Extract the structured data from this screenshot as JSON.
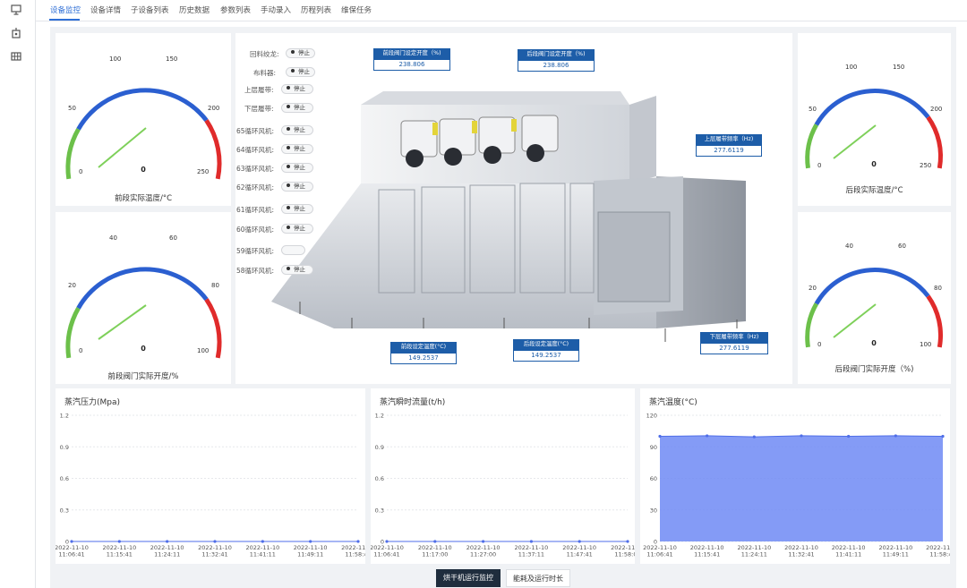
{
  "tabs": [
    "设备监控",
    "设备详情",
    "子设备列表",
    "历史数据",
    "参数列表",
    "手动录入",
    "历程列表",
    "维保任务"
  ],
  "left_rail_icons": [
    "monitor-icon",
    "device-icon",
    "grid-icon"
  ],
  "gauges": {
    "front_temp": {
      "title": "前段实际温度/°C",
      "value": "0",
      "ticks": [
        "0",
        "50",
        "100",
        "150",
        "200",
        "250"
      ]
    },
    "front_valve": {
      "title": "前段阀门实际开度/%",
      "value": "0",
      "ticks": [
        "0",
        "20",
        "40",
        "60",
        "80",
        "100"
      ]
    },
    "rear_temp": {
      "title": "后段实际温度/°C",
      "value": "0",
      "ticks": [
        "0",
        "50",
        "100",
        "150",
        "200",
        "250"
      ]
    },
    "rear_valve": {
      "title": "后段阀门实际开度（%)",
      "value": "0",
      "ticks": [
        "0",
        "20",
        "40",
        "60",
        "80",
        "100"
      ]
    }
  },
  "status": [
    {
      "label": "回料绞龙:",
      "value": "停止"
    },
    {
      "label": "布料器:",
      "value": "停止"
    },
    {
      "label": "上层履带:",
      "value": "停止"
    },
    {
      "label": "下层履带:",
      "value": "停止"
    },
    {
      "label": "65循环风机:",
      "value": "停止"
    },
    {
      "label": "64循环风机:",
      "value": "停止"
    },
    {
      "label": "63循环风机:",
      "value": "停止"
    },
    {
      "label": "62循环风机:",
      "value": "停止"
    },
    {
      "label": "61循环风机:",
      "value": "停止"
    },
    {
      "label": "60循环风机:",
      "value": "停止"
    },
    {
      "label": "59循环风机:",
      "value": ""
    },
    {
      "label": "58循环风机:",
      "value": "停止"
    }
  ],
  "valboxes": {
    "front_valve_set": {
      "label": "前段阀门设定开度（%)",
      "value": "238.806"
    },
    "rear_valve_set": {
      "label": "后段阀门设定开度（%)",
      "value": "238.806"
    },
    "upper_belt_freq": {
      "label": "上层履带频率（Hz)",
      "value": "277.6119"
    },
    "lower_belt_freq": {
      "label": "下层履带频率（Hz)",
      "value": "277.6119"
    },
    "front_temp_set": {
      "label": "前段设定温度(°C)",
      "value": "149.2537"
    },
    "rear_temp_set": {
      "label": "后段设定温度(°C)",
      "value": "149.2537"
    }
  },
  "charts": [
    {
      "title": "蒸汽压力(Mpa)"
    },
    {
      "title": "蒸汽瞬时流量(t/h)"
    },
    {
      "title": "蒸汽温度(°C)"
    }
  ],
  "chart_data": [
    {
      "type": "line",
      "title": "蒸汽压力(Mpa)",
      "ylim": [
        0,
        1.2
      ],
      "y_ticks": [
        "0",
        "0.3",
        "0.6",
        "0.9",
        "1.2"
      ],
      "x": [
        "2022-11-10\n11:06:41",
        "2022-11-10\n11:15:41",
        "2022-11-10\n11:24:11",
        "2022-11-10\n11:32:41",
        "2022-11-10\n11:41:11",
        "2022-11-10\n11:49:11",
        "2022-11-10\n11:58:41"
      ],
      "series": [
        {
          "values": [
            0,
            0,
            0,
            0,
            0,
            0,
            0
          ]
        }
      ]
    },
    {
      "type": "line",
      "title": "蒸汽瞬时流量(t/h)",
      "ylim": [
        0,
        1.2
      ],
      "y_ticks": [
        "0",
        "0.3",
        "0.6",
        "0.9",
        "1.2"
      ],
      "x": [
        "2022-11-10\n11:06:41",
        "2022-11-10\n11:17:00",
        "2022-11-10\n11:27:00",
        "2022-11-10\n11:37:11",
        "2022-11-10\n11:47:41",
        "2022-11-10\n11:58:08"
      ],
      "series": [
        {
          "values": [
            0,
            0,
            0,
            0,
            0,
            0
          ]
        }
      ]
    },
    {
      "type": "area",
      "title": "蒸汽温度(°C)",
      "ylim": [
        0,
        120
      ],
      "y_ticks": [
        "0",
        "30",
        "60",
        "90",
        "120"
      ],
      "x": [
        "2022-11-10\n11:06:41",
        "2022-11-10\n11:15:41",
        "2022-11-10\n11:24:11",
        "2022-11-10\n11:32:41",
        "2022-11-10\n11:41:11",
        "2022-11-10\n11:49:11",
        "2022-11-10\n11:58:41"
      ],
      "series": [
        {
          "values": [
            100,
            100.5,
            99.5,
            100.5,
            100,
            100.5,
            100
          ]
        }
      ]
    }
  ],
  "bottom_tabs": [
    "烘干机运行监控",
    "能耗及运行时长"
  ],
  "colors": {
    "accent": "#2f6fd6",
    "gauge_green": "#6cc04a",
    "gauge_blue": "#2b5fd0",
    "gauge_red": "#e02b2b",
    "needle": "#7ed05a",
    "box_blue": "#1d5da8",
    "area_fill": "#6f8af5"
  }
}
